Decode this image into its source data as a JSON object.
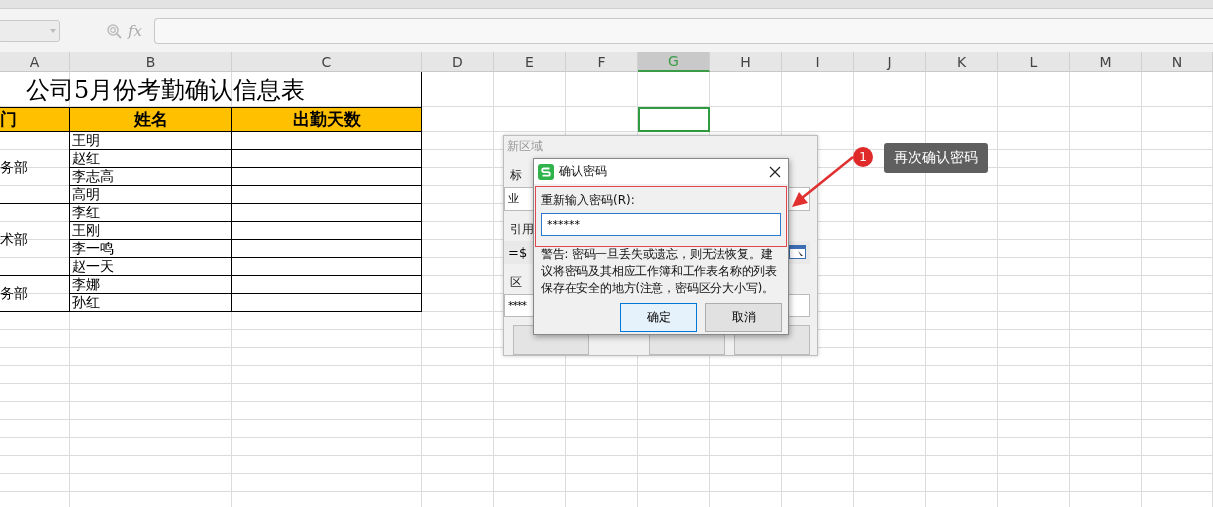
{
  "formula_bar": {
    "fx_label": "fx"
  },
  "columns": [
    {
      "label": "A",
      "selected": false
    },
    {
      "label": "B",
      "selected": false
    },
    {
      "label": "C",
      "selected": false
    },
    {
      "label": "D",
      "selected": false
    },
    {
      "label": "E",
      "selected": false
    },
    {
      "label": "F",
      "selected": false
    },
    {
      "label": "G",
      "selected": true
    },
    {
      "label": "H",
      "selected": false
    },
    {
      "label": "I",
      "selected": false
    },
    {
      "label": "J",
      "selected": false
    },
    {
      "label": "K",
      "selected": false
    },
    {
      "label": "L",
      "selected": false
    },
    {
      "label": "M",
      "selected": false
    },
    {
      "label": "N",
      "selected": false
    }
  ],
  "sheet": {
    "title": "公司5月份考勤确认信息表",
    "headers": [
      "门",
      "姓名",
      "出勤天数"
    ],
    "groups": [
      {
        "department": "务部",
        "names": [
          "王明",
          "赵红",
          "李志高",
          "高明"
        ]
      },
      {
        "department": "术部",
        "names": [
          "李红",
          "王刚",
          "李一鸣",
          "赵一天"
        ]
      },
      {
        "department": "务部",
        "names": [
          "李娜",
          "孙红"
        ]
      }
    ]
  },
  "back_dialog": {
    "title": "新区域",
    "labels": [
      "标",
      "引用",
      "区"
    ],
    "fields": [
      "业",
      "=$",
      "****"
    ]
  },
  "dialog": {
    "title": "确认密码",
    "label": "重新输入密码(R):",
    "value": "******",
    "warning": "警告: 密码一旦丢失或遗忘，则无法恢复。建议将密码及其相应工作簿和工作表名称的列表保存在安全的地方(注意，密码区分大小写)。",
    "buttons": [
      {
        "label": "确定",
        "default": true
      },
      {
        "label": "取消",
        "default": false
      }
    ]
  },
  "callout": {
    "badge": "1",
    "text": "再次确认密码"
  }
}
